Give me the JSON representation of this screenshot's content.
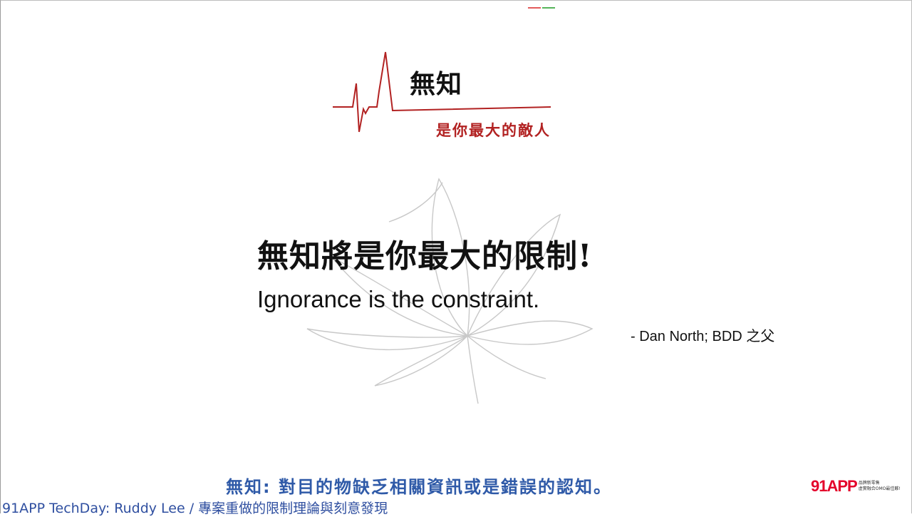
{
  "slide": {
    "title": "無知",
    "subtitle": "是你最大的敵人",
    "quote_zh": "無知將是你最大的限制!",
    "quote_en": "Ignorance is the constraint.",
    "attribution": "- Dan North; BDD 之父",
    "definition": "無知: 對目的物缺乏相關資訊或是錯誤的認知。"
  },
  "brand": {
    "logo_text": "91APP",
    "tagline_line1": "品牌新零售",
    "tagline_line2": "虛實融合OMO最佳夥!"
  },
  "footer": {
    "text": "91APP TechDay: Ruddy Lee / 專案重做的限制理論與刻意發現"
  },
  "colors": {
    "accent_red": "#b22222",
    "definition_blue": "#2f5aa8",
    "footer_blue": "#2f4fa0",
    "logo_red": "#e4002b"
  },
  "icons": {
    "pulse": "heartbeat-line-graphic",
    "lotus": "lotus-sketch-graphic"
  }
}
